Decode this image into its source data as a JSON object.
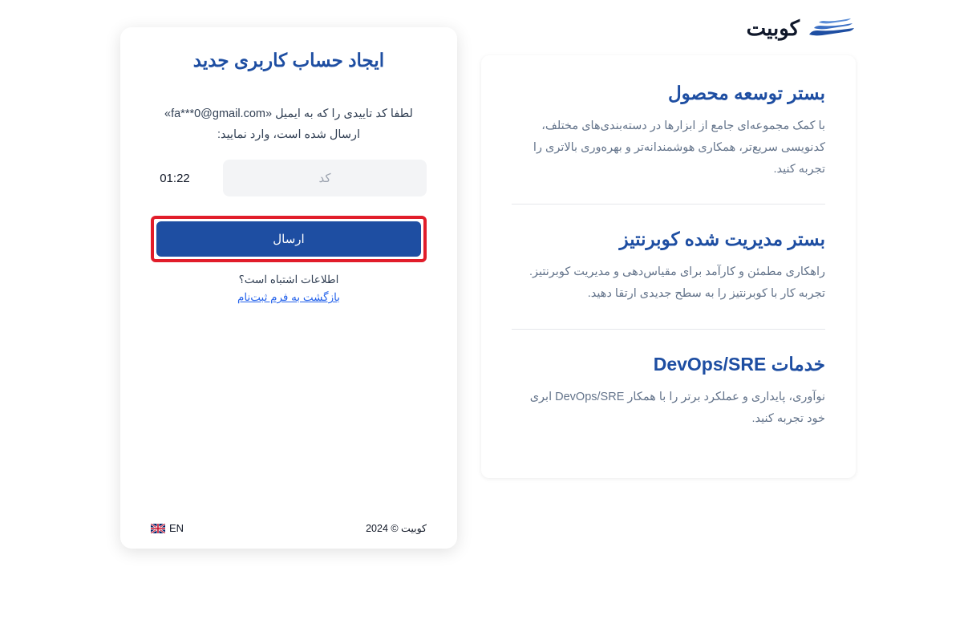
{
  "header": {
    "brand": "کوبیت"
  },
  "features": {
    "items": [
      {
        "title": "بستر توسعه محصول",
        "desc": "با کمک مجموعه‌ای جامع از ابزارها در دسته‌بندی‌های مختلف، کدنویسی سریع‌تر، همکاری هوشمندانه‌تر و بهره‌وری بالاتری را تجربه کنید."
      },
      {
        "title": "بستر مدیریت شده کوبرنتیز",
        "desc": "راهکاری مطمئن و کارآمد برای مقیاس‌دهی و مدیریت کوبرنتیز. تجربه کار با کوبرنتیز را به سطح جدیدی ارتقا دهید."
      },
      {
        "title": "خدمات DevOps/SRE",
        "desc": "نوآوری، پایداری و عملکرد برتر را با همکار DevOps/SRE ابری خود تجربه کنید."
      }
    ]
  },
  "form": {
    "title": "ایجاد حساب کاربری جدید",
    "instruction_prefix": "لطفا کد تاییدی را که به ایمیل «",
    "email": "fa***0@gmail.com",
    "instruction_suffix": "» ارسال شده است، وارد نمایید:",
    "timer": "01:22",
    "code_placeholder": "کد",
    "submit_label": "ارسال",
    "wrong_info_label": "اطلاعات اشتباه است؟",
    "back_label": "بازگشت به فرم ثبت‌نام"
  },
  "footer": {
    "lang_label": "EN",
    "copyright": "کوبیت © 2024"
  }
}
